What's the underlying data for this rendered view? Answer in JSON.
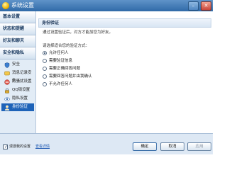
{
  "window": {
    "title": "系统设置"
  },
  "sidebar": {
    "categories": [
      {
        "label": "基本设置"
      },
      {
        "label": "状态和提醒"
      },
      {
        "label": "好友和聊天"
      },
      {
        "label": "安全和隐私"
      }
    ],
    "items": [
      {
        "label": "安全",
        "icon": "shield-icon"
      },
      {
        "label": "消息记录安全",
        "icon": "message-lock-icon"
      },
      {
        "label": "防骚扰设置",
        "icon": "anti-harass-icon"
      },
      {
        "label": "QQ锁设置",
        "icon": "lock-icon"
      },
      {
        "label": "隐私设置",
        "icon": "privacy-icon"
      },
      {
        "label": "身份验证",
        "icon": "identity-icon",
        "active": true
      }
    ]
  },
  "content": {
    "section_title": "身份验证",
    "description": "通过设置验证后，对方才能加您为好友。",
    "prompt": "请选择适合您的验证方式：",
    "options": [
      {
        "label": "允许任何人",
        "checked": true
      },
      {
        "label": "需要验证信息",
        "checked": false
      },
      {
        "label": "需要正确回答问题",
        "checked": false
      },
      {
        "label": "需要回答问题并由我确认",
        "checked": false
      },
      {
        "label": "不允许任何人",
        "checked": false
      }
    ]
  },
  "footer": {
    "remember_label": "漫游我的设置",
    "remember_checked": true,
    "details_link": "查看详情",
    "ok_label": "确定",
    "cancel_label": "取消",
    "apply_label": "应用"
  },
  "colors": {
    "titlebar": "#2f6aa8",
    "active_item": "#1e63b8",
    "link": "#1a56b0"
  }
}
